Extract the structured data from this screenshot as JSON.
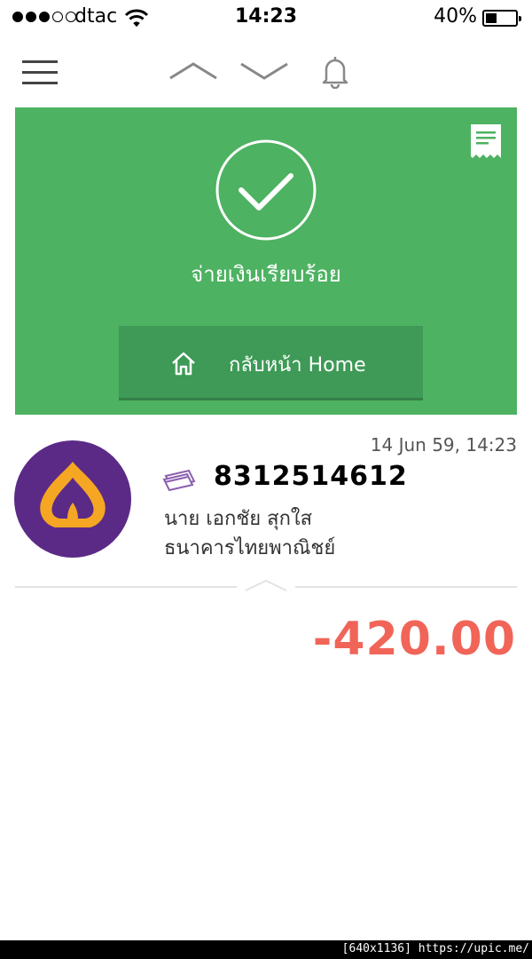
{
  "status_bar": {
    "carrier": "dtac",
    "time": "14:23",
    "battery": "40%",
    "battery_level": 0.4,
    "signal_bars": 3
  },
  "nav": {
    "icons": [
      "menu-icon",
      "chevron-up-icon",
      "chevron-down-icon",
      "bell-icon"
    ]
  },
  "success_panel": {
    "message": "จ่ายเงินเรียบร้อย",
    "home_button": "กลับหน้า Home",
    "background_color": "#4db261"
  },
  "transaction": {
    "datetime": "14 Jun 59, 14:23",
    "account_number": "8312514612",
    "recipient_name": "นาย เอกชัย สุกใส",
    "bank_name": "ธนาคารไทยพาณิชย์",
    "amount": "-420.00",
    "amount_color": "#f06558",
    "bank_logo_color": "#5b2a86"
  },
  "footer": {
    "tag": "[640x1136] https://upic.me/"
  }
}
